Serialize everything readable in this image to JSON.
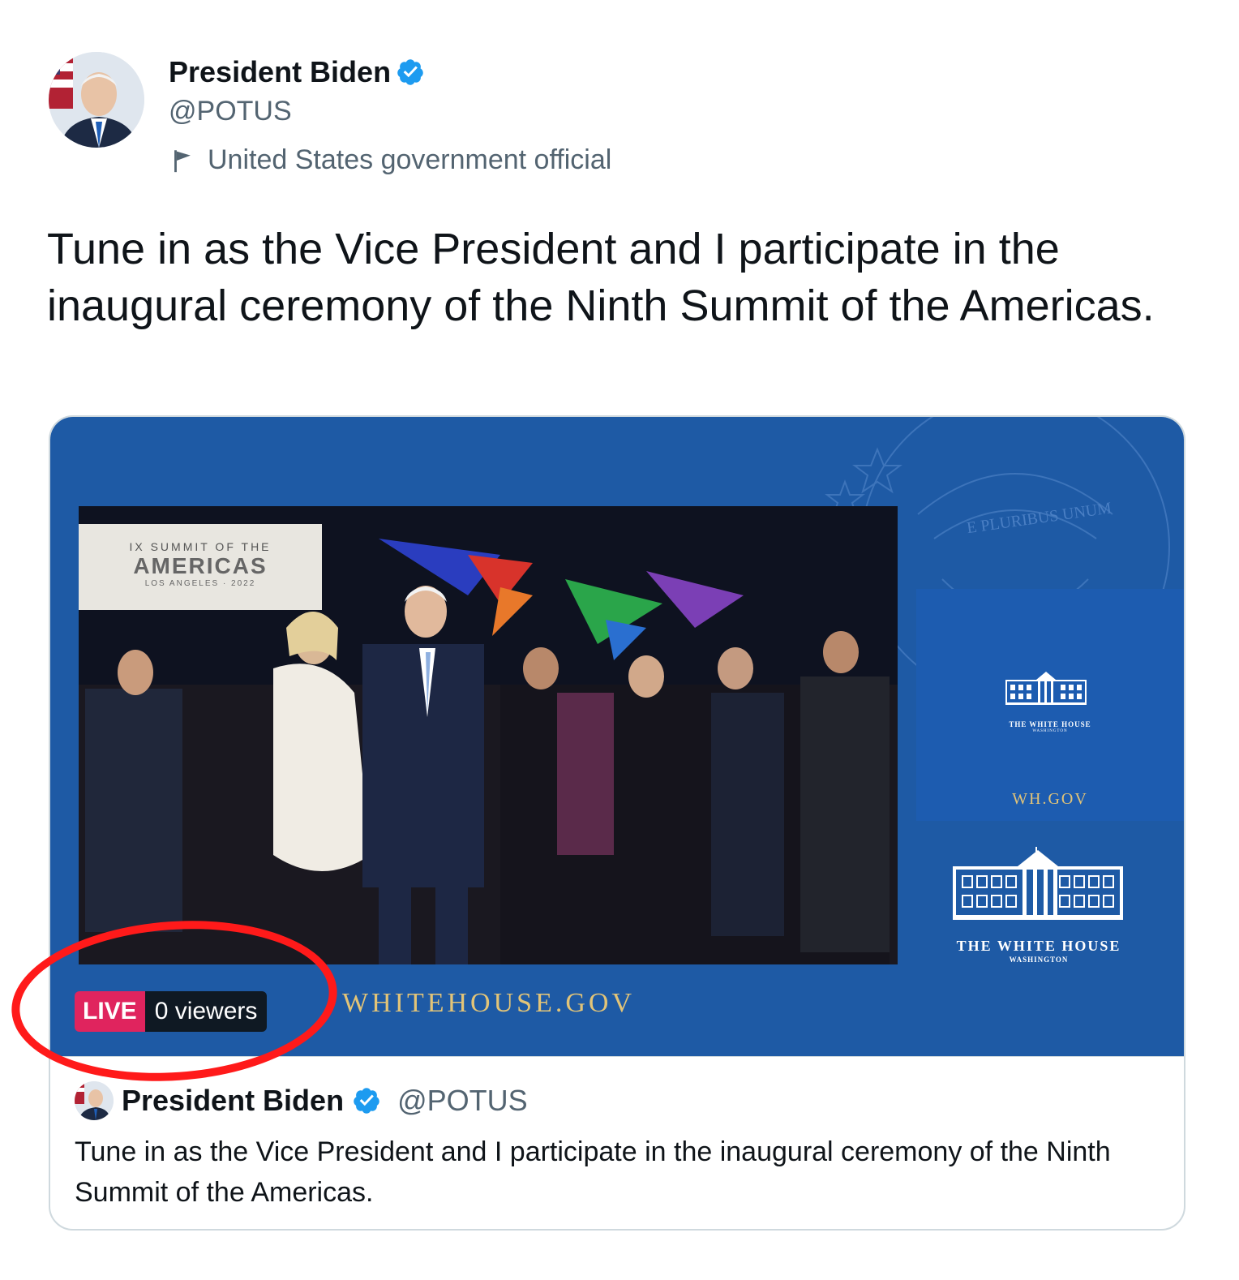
{
  "tweet": {
    "author_name": "President Biden",
    "handle": "@POTUS",
    "label": "United States government official",
    "text": "Tune in as the Vice President and I participate in the inaugural ceremony of the Ninth Summit of the Americas."
  },
  "card": {
    "banner_line1": "IX SUMMIT OF THE",
    "banner_line2": "AMERICAS",
    "banner_line3": "LOS ANGELES · 2022",
    "motto": "E PLURIBUS UNUM",
    "wh_small_title": "THE WHITE HOUSE",
    "wh_small_sub": "WASHINGTON",
    "wh_gov": "WH.GOV",
    "wh_title": "THE WHITE HOUSE",
    "wh_sub": "WASHINGTON",
    "whitehouse_gov": "WHITEHOUSE.GOV",
    "live_label": "LIVE",
    "viewers": "0 viewers",
    "footer": {
      "author_name": "President Biden",
      "handle": "@POTUS",
      "text": "Tune in as the Vice President and I participate in the inaugural ceremony of the Ninth Summit of the Americas."
    }
  },
  "colors": {
    "verified": "#1d9bf0",
    "live": "#e0245e",
    "annotation_circle": "#ff1a1a",
    "video_bg": "#1e5aa5"
  }
}
